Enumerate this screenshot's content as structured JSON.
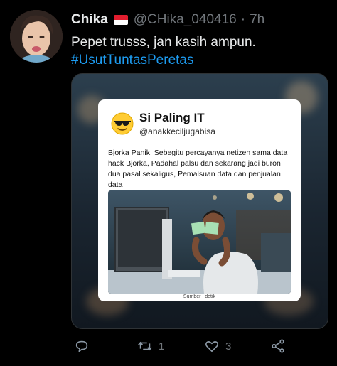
{
  "tweet": {
    "name": "Chika",
    "handle": "@CHika_040416",
    "separator": "·",
    "time": "7h",
    "text": "Pepet trusss, jan kasih ampun.",
    "hashtag": "#UsutTuntasPeretas"
  },
  "card": {
    "name": "Si Paling IT",
    "handle": "@anakkeciljugabisa",
    "body": "Bjorka Panik, Sebegitu percayanya netizen sama data hack Bjorka, Padahal palsu dan sekarang jadi buron dua pasal sekaligus, Pemalsuan data dan penjualan data",
    "credit": "Sumber : detik"
  },
  "actions": {
    "reply_count": "",
    "retweet_count": "1",
    "like_count": "3"
  },
  "icons": [
    "reply-icon",
    "retweet-icon",
    "like-icon",
    "share-icon",
    "sunglasses-emoji-icon",
    "indonesia-flag-icon"
  ],
  "colors": {
    "background": "#000000",
    "text": "#e7e9ea",
    "muted": "#71767b",
    "link": "#1d9bf0"
  }
}
